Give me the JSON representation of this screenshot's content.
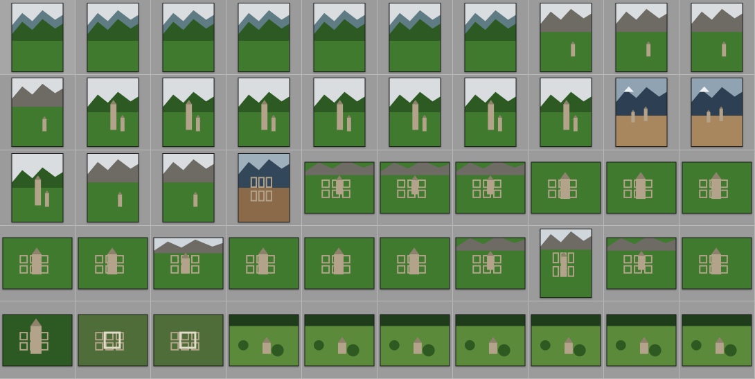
{
  "grid": {
    "columns": 10,
    "rows": [
      [
        {
          "o": "portrait",
          "s": "valley"
        },
        {
          "o": "portrait",
          "s": "valley"
        },
        {
          "o": "portrait",
          "s": "valley"
        },
        {
          "o": "portrait",
          "s": "valley"
        },
        {
          "o": "portrait",
          "s": "valley"
        },
        {
          "o": "portrait",
          "s": "valley"
        },
        {
          "o": "portrait",
          "s": "valley"
        },
        {
          "o": "portrait",
          "s": "ridge"
        },
        {
          "o": "portrait",
          "s": "ridge"
        },
        {
          "o": "portrait",
          "s": "ridge"
        }
      ],
      [
        {
          "o": "portrait",
          "s": "ridge"
        },
        {
          "o": "portrait",
          "s": "tower"
        },
        {
          "o": "portrait",
          "s": "tower"
        },
        {
          "o": "portrait",
          "s": "tower"
        },
        {
          "o": "portrait",
          "s": "tower"
        },
        {
          "o": "portrait",
          "s": "tower"
        },
        {
          "o": "portrait",
          "s": "tower"
        },
        {
          "o": "portrait",
          "s": "tower"
        },
        {
          "o": "portrait",
          "s": "snow"
        },
        {
          "o": "portrait",
          "s": "snow"
        }
      ],
      [
        {
          "o": "portrait",
          "s": "tower"
        },
        {
          "o": "portrait",
          "s": "ridge"
        },
        {
          "o": "portrait",
          "s": "ridge"
        },
        {
          "o": "portrait",
          "s": "snow-brown"
        },
        {
          "o": "landscape",
          "s": "ruins-hill"
        },
        {
          "o": "landscape",
          "s": "ruins-hill"
        },
        {
          "o": "landscape",
          "s": "ruins-hill"
        },
        {
          "o": "landscape",
          "s": "ruins"
        },
        {
          "o": "landscape",
          "s": "ruins"
        },
        {
          "o": "landscape",
          "s": "ruins"
        }
      ],
      [
        {
          "o": "landscape",
          "s": "ruins"
        },
        {
          "o": "landscape",
          "s": "ruins"
        },
        {
          "o": "landscape",
          "s": "ruins-sky"
        },
        {
          "o": "landscape",
          "s": "ruins"
        },
        {
          "o": "landscape",
          "s": "ruins"
        },
        {
          "o": "landscape",
          "s": "ruins"
        },
        {
          "o": "landscape",
          "s": "ruins-hill"
        },
        {
          "o": "portrait",
          "s": "ruins-sky"
        },
        {
          "o": "landscape",
          "s": "ruins-hill"
        },
        {
          "o": "landscape",
          "s": "ruins"
        }
      ],
      [
        {
          "o": "landscape",
          "s": "ruins-dark"
        },
        {
          "o": "landscape",
          "s": "ruins-top"
        },
        {
          "o": "landscape",
          "s": "ruins-top"
        },
        {
          "o": "landscape",
          "s": "field"
        },
        {
          "o": "landscape",
          "s": "field"
        },
        {
          "o": "landscape",
          "s": "field"
        },
        {
          "o": "landscape",
          "s": "field"
        },
        {
          "o": "landscape",
          "s": "field"
        },
        {
          "o": "landscape",
          "s": "field"
        },
        {
          "o": "landscape",
          "s": "field"
        }
      ]
    ]
  },
  "colors": {
    "background": "#9a9a9a",
    "cell_border": "#b8b8b8",
    "thumb_border": "#1e1e1e",
    "grass": "#3f7a2f",
    "grass_dark": "#2c5a22",
    "stone": "#b3a38a",
    "sky": "#d9dde0",
    "snow": "#eef1f3",
    "rock": "#6e6a64"
  }
}
